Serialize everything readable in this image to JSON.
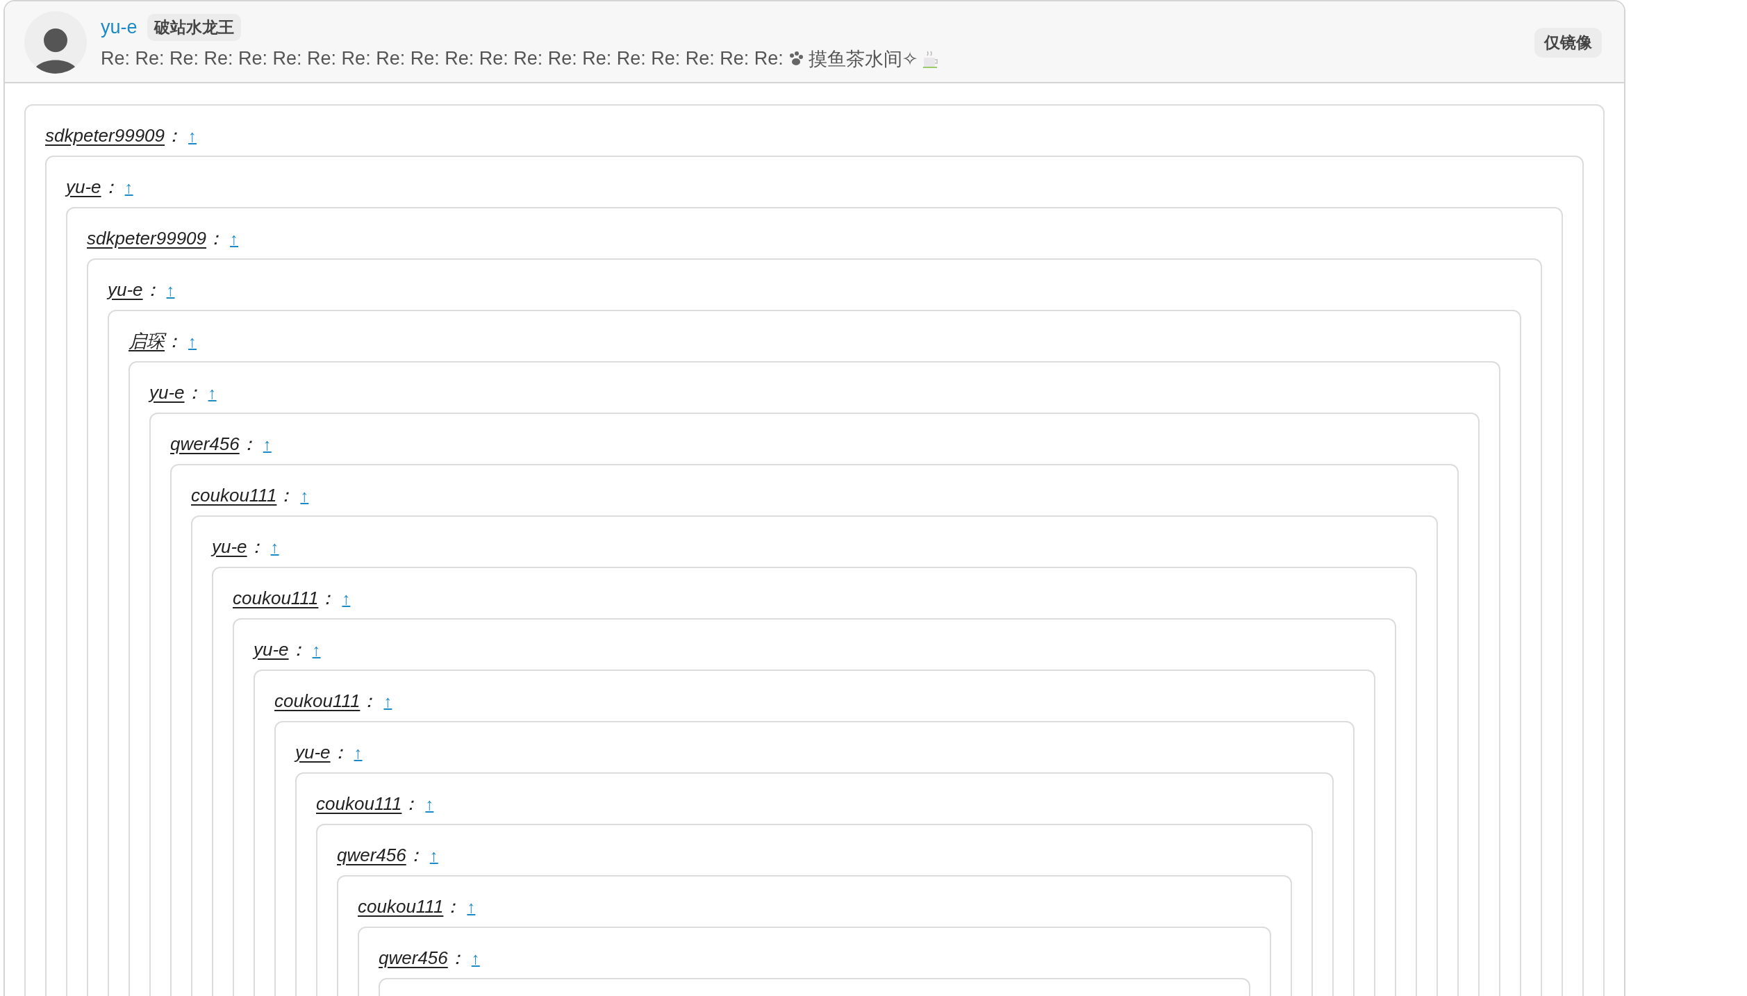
{
  "post": {
    "author": "yu-e",
    "badge": "破站水龙王",
    "title": "Re: Re: Re: Re: Re: Re: Re: Re: Re: Re: Re: Re: Re: Re: Re: Re: Re: Re: Re: Re:",
    "topic": "摸鱼茶水间✧",
    "mirror_tag": "仅镜像"
  },
  "quotes": [
    {
      "author": "sdkpeter99909",
      "sep": "：",
      "link": "↑",
      "children": [
        {
          "author": "yu-e",
          "sep": "：",
          "link": "↑",
          "children": [
            {
              "author": "sdkpeter99909",
              "sep": "：",
              "link": "↑",
              "children": [
                {
                  "author": "yu-e",
                  "sep": "：",
                  "link": "↑",
                  "children": [
                    {
                      "author": "启琛",
                      "sep": "：",
                      "link": "↑",
                      "children": [
                        {
                          "author": "yu-e",
                          "sep": "：",
                          "link": "↑",
                          "children": [
                            {
                              "author": "qwer456",
                              "sep": "：",
                              "link": "↑",
                              "children": [
                                {
                                  "author": "coukou111",
                                  "sep": "：",
                                  "link": "↑",
                                  "children": [
                                    {
                                      "author": "yu-e",
                                      "sep": "：",
                                      "link": "↑",
                                      "children": [
                                        {
                                          "author": "coukou111",
                                          "sep": "：",
                                          "link": "↑",
                                          "children": [
                                            {
                                              "author": "yu-e",
                                              "sep": "：",
                                              "link": "↑",
                                              "children": [
                                                {
                                                  "author": "coukou111",
                                                  "sep": "：",
                                                  "link": "↑",
                                                  "children": [
                                                    {
                                                      "author": "yu-e",
                                                      "sep": "：",
                                                      "link": "↑",
                                                      "children": [
                                                        {
                                                          "author": "coukou111",
                                                          "sep": "：",
                                                          "link": "↑",
                                                          "children": [
                                                            {
                                                              "author": "qwer456",
                                                              "sep": "：",
                                                              "link": "↑",
                                                              "children": [
                                                                {
                                                                  "author": "coukou111",
                                                                  "sep": "：",
                                                                  "link": "↑",
                                                                  "children": [
                                                                    {
                                                                      "author": "qwer456",
                                                                      "sep": "：",
                                                                      "link": "↑"
                                                                    }
                                                                  ]
                                                                }
                                                              ]
                                                            }
                                                          ]
                                                        }
                                                      ]
                                                    }
                                                  ]
                                                }
                                              ]
                                            }
                                          ]
                                        }
                                      ]
                                    }
                                  ]
                                }
                              ]
                            }
                          ]
                        }
                      ]
                    }
                  ]
                }
              ]
            }
          ]
        }
      ]
    }
  ]
}
